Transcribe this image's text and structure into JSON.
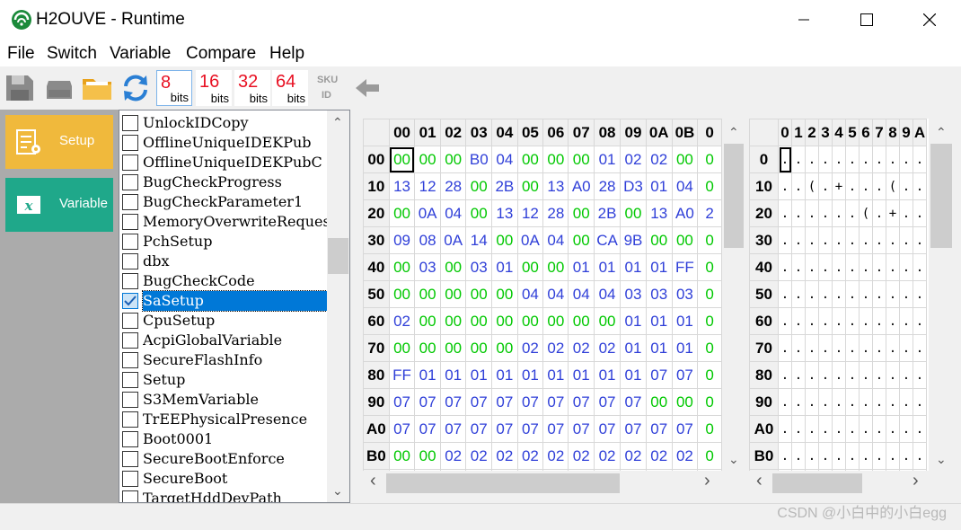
{
  "window": {
    "title": "H2OUVE - Runtime",
    "minimize_glyph": "—",
    "maximize_glyph": "☐",
    "close_glyph": "✕"
  },
  "menu": {
    "items": [
      "File",
      "Switch",
      "Variable",
      "Compare",
      "Help"
    ]
  },
  "toolbar": {
    "icons": [
      "save-icon",
      "disk-icon",
      "folder-open-icon",
      "refresh-icon",
      "sku-id-icon",
      "back-arrow-icon"
    ],
    "sku_text": "SKU",
    "id_text": "ID",
    "bits_buttons": [
      {
        "num": "8",
        "label": "bits",
        "selected": true
      },
      {
        "num": "16",
        "label": "bits",
        "selected": false
      },
      {
        "num": "32",
        "label": "bits",
        "selected": false
      },
      {
        "num": "64",
        "label": "bits",
        "selected": false
      }
    ]
  },
  "nav": {
    "setup_label": "Setup",
    "variable_label": "Variable",
    "setup_color": "#f0b93c",
    "variable_color": "#1fa88a"
  },
  "variables": {
    "selected_index": 9,
    "items": [
      "UnlockIDCopy",
      "OfflineUniqueIDEKPub",
      "OfflineUniqueIDEKPubC",
      "BugCheckProgress",
      "BugCheckParameter1",
      "MemoryOverwriteReques",
      "PchSetup",
      "dbx",
      "BugCheckCode",
      "SaSetup",
      "CpuSetup",
      "AcpiGlobalVariable",
      "SecureFlashInfo",
      "Setup",
      "S3MemVariable",
      "TrEEPhysicalPresence",
      "Boot0001",
      "SecureBootEnforce",
      "SecureBoot",
      "TargetHddDevPath"
    ]
  },
  "hex": {
    "col_headers": [
      "00",
      "01",
      "02",
      "03",
      "04",
      "05",
      "06",
      "07",
      "08",
      "09",
      "0A",
      "0B",
      "0"
    ],
    "rows": [
      {
        "h": "00",
        "v": [
          "00",
          "00",
          "00",
          "B0",
          "04",
          "00",
          "00",
          "00",
          "01",
          "02",
          "02",
          "00",
          "0"
        ]
      },
      {
        "h": "10",
        "v": [
          "13",
          "12",
          "28",
          "00",
          "2B",
          "00",
          "13",
          "A0",
          "28",
          "D3",
          "01",
          "04",
          "0"
        ]
      },
      {
        "h": "20",
        "v": [
          "00",
          "0A",
          "04",
          "00",
          "13",
          "12",
          "28",
          "00",
          "2B",
          "00",
          "13",
          "A0",
          "2"
        ]
      },
      {
        "h": "30",
        "v": [
          "09",
          "08",
          "0A",
          "14",
          "00",
          "0A",
          "04",
          "00",
          "CA",
          "9B",
          "00",
          "00",
          "0"
        ]
      },
      {
        "h": "40",
        "v": [
          "00",
          "03",
          "00",
          "03",
          "01",
          "00",
          "00",
          "01",
          "01",
          "01",
          "01",
          "FF",
          "0"
        ]
      },
      {
        "h": "50",
        "v": [
          "00",
          "00",
          "00",
          "00",
          "00",
          "04",
          "04",
          "04",
          "04",
          "03",
          "03",
          "03",
          "0"
        ]
      },
      {
        "h": "60",
        "v": [
          "02",
          "00",
          "00",
          "00",
          "00",
          "00",
          "00",
          "00",
          "00",
          "01",
          "01",
          "01",
          "0"
        ]
      },
      {
        "h": "70",
        "v": [
          "00",
          "00",
          "00",
          "00",
          "00",
          "02",
          "02",
          "02",
          "02",
          "01",
          "01",
          "01",
          "0"
        ]
      },
      {
        "h": "80",
        "v": [
          "FF",
          "01",
          "01",
          "01",
          "01",
          "01",
          "01",
          "01",
          "01",
          "01",
          "07",
          "07",
          "0"
        ]
      },
      {
        "h": "90",
        "v": [
          "07",
          "07",
          "07",
          "07",
          "07",
          "07",
          "07",
          "07",
          "07",
          "07",
          "00",
          "00",
          "0"
        ]
      },
      {
        "h": "A0",
        "v": [
          "07",
          "07",
          "07",
          "07",
          "07",
          "07",
          "07",
          "07",
          "07",
          "07",
          "07",
          "07",
          "0"
        ]
      },
      {
        "h": "B0",
        "v": [
          "00",
          "00",
          "02",
          "02",
          "02",
          "02",
          "02",
          "02",
          "02",
          "02",
          "02",
          "02",
          "0"
        ]
      },
      {
        "h": "",
        "v": [
          "",
          "",
          "",
          "",
          "",
          "",
          "",
          "",
          "",
          "",
          "",
          "",
          ""
        ]
      }
    ],
    "zero_color": "#00c800",
    "nonzero_color": "#2f3fd8"
  },
  "ascii": {
    "col_headers": [
      "0",
      "1",
      "2",
      "3",
      "4",
      "5",
      "6",
      "7",
      "8",
      "9",
      "A"
    ],
    "rows": [
      {
        "h": "0",
        "v": [
          ".",
          ".",
          ".",
          ".",
          ".",
          ".",
          ".",
          ".",
          ".",
          ".",
          "."
        ]
      },
      {
        "h": "10",
        "v": [
          ".",
          ".",
          "(",
          ".",
          "+",
          ".",
          ".",
          ".",
          "(",
          ".",
          "."
        ]
      },
      {
        "h": "20",
        "v": [
          ".",
          ".",
          ".",
          ".",
          ".",
          ".",
          "(",
          ".",
          "+",
          ".",
          "."
        ]
      },
      {
        "h": "30",
        "v": [
          ".",
          ".",
          ".",
          ".",
          ".",
          ".",
          ".",
          ".",
          ".",
          ".",
          "."
        ]
      },
      {
        "h": "40",
        "v": [
          ".",
          ".",
          ".",
          ".",
          ".",
          ".",
          ".",
          ".",
          ".",
          ".",
          "."
        ]
      },
      {
        "h": "50",
        "v": [
          ".",
          ".",
          ".",
          ".",
          ".",
          ".",
          ".",
          ".",
          ".",
          ".",
          "."
        ]
      },
      {
        "h": "60",
        "v": [
          ".",
          ".",
          ".",
          ".",
          ".",
          ".",
          ".",
          ".",
          ".",
          ".",
          "."
        ]
      },
      {
        "h": "70",
        "v": [
          ".",
          ".",
          ".",
          ".",
          ".",
          ".",
          ".",
          ".",
          ".",
          ".",
          "."
        ]
      },
      {
        "h": "80",
        "v": [
          ".",
          ".",
          ".",
          ".",
          ".",
          ".",
          ".",
          ".",
          ".",
          ".",
          "."
        ]
      },
      {
        "h": "90",
        "v": [
          ".",
          ".",
          ".",
          ".",
          ".",
          ".",
          ".",
          ".",
          ".",
          ".",
          "."
        ]
      },
      {
        "h": "A0",
        "v": [
          ".",
          ".",
          ".",
          ".",
          ".",
          ".",
          ".",
          ".",
          ".",
          ".",
          "."
        ]
      },
      {
        "h": "B0",
        "v": [
          ".",
          ".",
          ".",
          ".",
          ".",
          ".",
          ".",
          ".",
          ".",
          ".",
          "."
        ]
      },
      {
        "h": "",
        "v": [
          "",
          "",
          "",
          "",
          "",
          "",
          "",
          "",
          "",
          "",
          ""
        ]
      }
    ]
  },
  "scroll": {
    "up": "⌃",
    "down": "⌄",
    "left": "‹",
    "right": "›"
  },
  "status": {
    "watermark": "CSDN @小白中的小白egg"
  }
}
